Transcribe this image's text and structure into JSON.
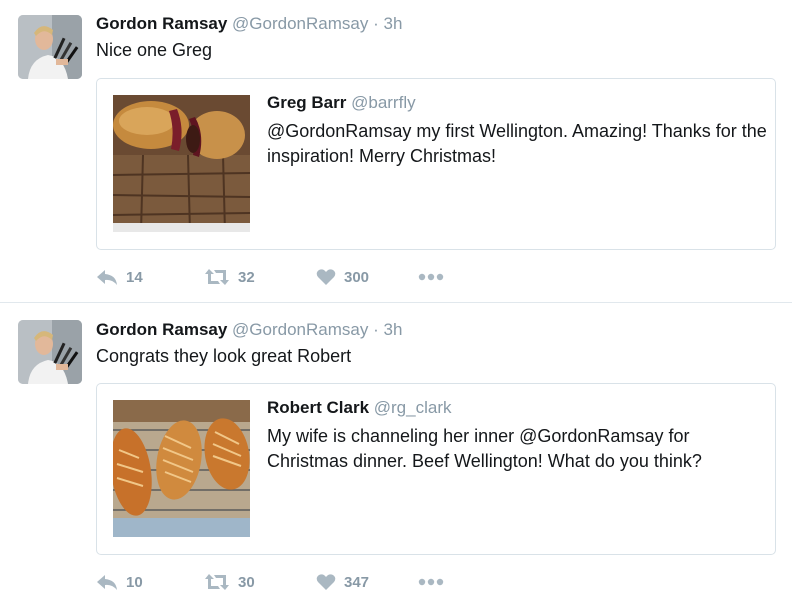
{
  "tweets": [
    {
      "author": {
        "name": "Gordon Ramsay",
        "handle": "@GordonRamsay",
        "time": "3h"
      },
      "text": "Nice one Greg",
      "quoted": {
        "name": "Greg Barr",
        "handle": "@barrfly",
        "text": "@GordonRamsay my first Wellington. Amazing! Thanks for the inspiration! Merry Christmas!"
      },
      "actions": {
        "replies": "14",
        "retweets": "32",
        "likes": "300"
      }
    },
    {
      "author": {
        "name": "Gordon Ramsay",
        "handle": "@GordonRamsay",
        "time": "3h"
      },
      "text": "Congrats they look great Robert",
      "quoted": {
        "name": "Robert Clark",
        "handle": "@rg_clark",
        "text": "My wife is channeling her inner @GordonRamsay for Christmas dinner. Beef Wellington! What do you think?"
      },
      "actions": {
        "replies": "10",
        "retweets": "30",
        "likes": "347"
      }
    }
  ],
  "separator": "·",
  "icons": {
    "reply": "reply-icon",
    "retweet": "retweet-icon",
    "like": "heart-icon",
    "more": "more-icon"
  },
  "colors": {
    "name": "#14171a",
    "meta": "#8899a6",
    "border": "#d9e2e8"
  }
}
